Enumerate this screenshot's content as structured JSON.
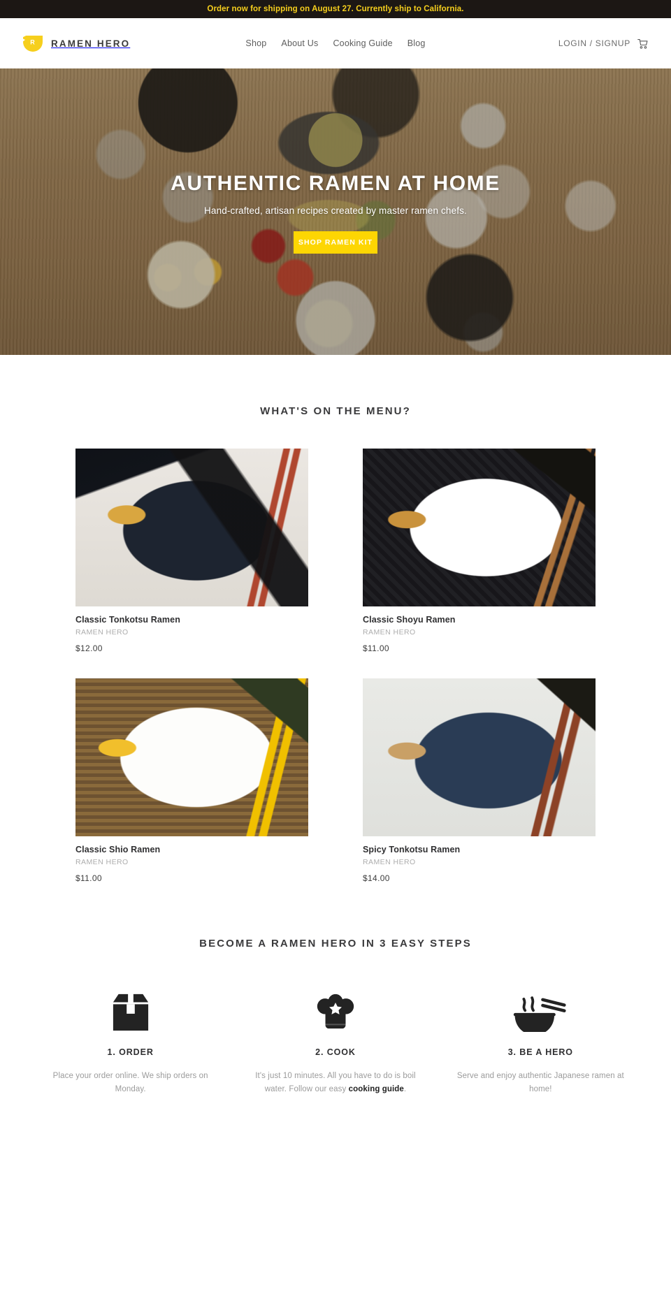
{
  "announcement": {
    "text": "Order now for shipping on August 27. Currently ship to California.",
    "bg_color": "#1c1714",
    "text_color": "#f6cf1d"
  },
  "header": {
    "brand_name": "RAMEN HERO",
    "logo_letter": "R",
    "logo_color": "#f6cf1d",
    "nav": [
      {
        "label": "Shop"
      },
      {
        "label": "About Us"
      },
      {
        "label": "Cooking Guide"
      },
      {
        "label": "Blog"
      }
    ],
    "login_label": "LOGIN / SIGNUP",
    "cart_icon": "shopping-cart-icon"
  },
  "hero": {
    "title": "AUTHENTIC RAMEN AT HOME",
    "subtitle": "Hand-crafted, artisan recipes created by master ramen chefs.",
    "cta_label": "SHOP RAMEN KIT",
    "cta_color": "#fdd603"
  },
  "menu": {
    "title": "WHAT'S ON THE MENU?",
    "products": [
      {
        "title": "Classic Tonkotsu Ramen",
        "vendor": "RAMEN HERO",
        "price": "$12.00",
        "image_class": "ph-tonkotsu"
      },
      {
        "title": "Classic Shoyu Ramen",
        "vendor": "RAMEN HERO",
        "price": "$11.00",
        "image_class": "ph-shoyu"
      },
      {
        "title": "Classic Shio Ramen",
        "vendor": "RAMEN HERO",
        "price": "$11.00",
        "image_class": "ph-shio"
      },
      {
        "title": "Spicy Tonkotsu Ramen",
        "vendor": "RAMEN HERO",
        "price": "$14.00",
        "image_class": "ph-spicy"
      }
    ]
  },
  "steps": {
    "title": "BECOME A RAMEN HERO IN 3 EASY STEPS",
    "items": [
      {
        "icon": "package-box-icon",
        "title": "1. ORDER",
        "desc_before": "Place your order online. We ship orders on Monday.",
        "desc_link": "",
        "desc_after": ""
      },
      {
        "icon": "chef-hat-icon",
        "title": "2. COOK",
        "desc_before": "It's just 10 minutes. All you have to do is boil water. Follow our easy ",
        "desc_link": "cooking guide",
        "desc_after": "."
      },
      {
        "icon": "ramen-bowl-chopsticks-icon",
        "title": "3. BE A HERO",
        "desc_before": "Serve and enjoy authentic Japanese ramen at home!",
        "desc_link": "",
        "desc_after": ""
      }
    ]
  }
}
